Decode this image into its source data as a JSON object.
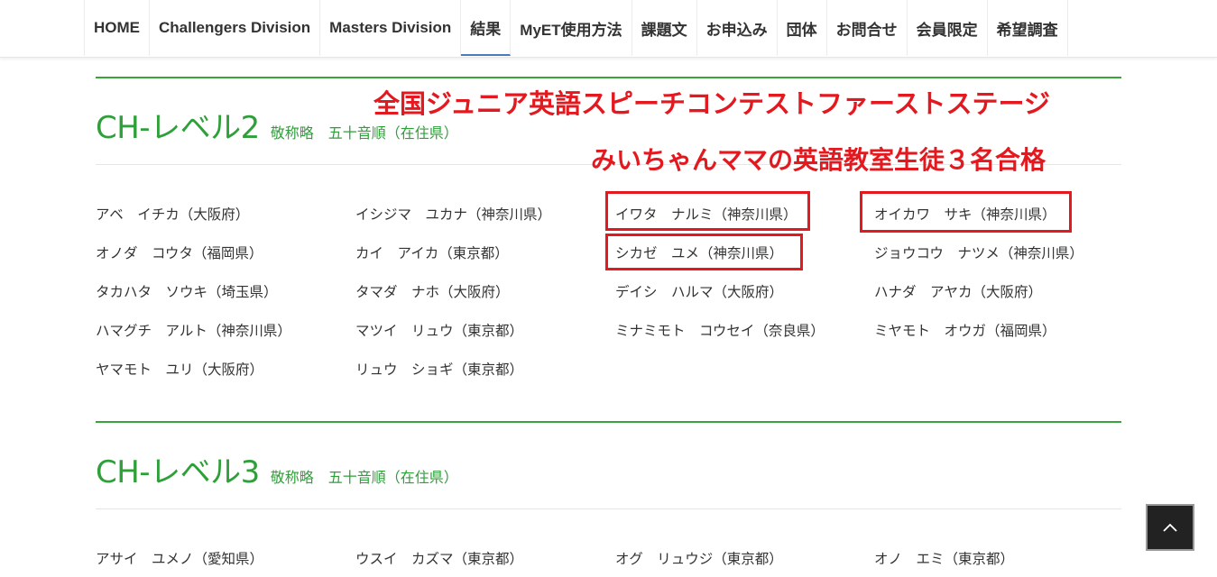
{
  "nav": {
    "items": [
      "HOME",
      "Challengers Division",
      "Masters Division",
      "結果",
      "MyET使用方法",
      "課題文",
      "お申込み",
      "団体",
      "お問合せ",
      "会員限定",
      "希望調査"
    ],
    "active_index": 3
  },
  "annotation": {
    "line1": "全国ジュニア英語スピーチコンテストファーストステージ",
    "line2": "みいちゃんママの英語教室生徒３名合格",
    "color": "#e3191f"
  },
  "sections": [
    {
      "title": "CH-レベル2",
      "subtitle": "敬称略　五十音順（在住県）",
      "names": [
        "アベ　イチカ（大阪府）",
        "イシジマ　ユカナ（神奈川県）",
        "イワタ　ナルミ（神奈川県）",
        "オイカワ　サキ（神奈川県）",
        "オノダ　コウタ（福岡県）",
        "カイ　アイカ（東京都）",
        "シカゼ　ユメ（神奈川県）",
        "ジョウコウ　ナツメ（神奈川県）",
        "タカハタ　ソウキ（埼玉県）",
        "タマダ　ナホ（大阪府）",
        "デイシ　ハルマ（大阪府）",
        "ハナダ　アヤカ（大阪府）",
        "ハマグチ　アルト（神奈川県）",
        "マツイ　リュウ（東京都）",
        "ミナミモト　コウセイ（奈良県）",
        "ミヤモト　オウガ（福岡県）",
        "ヤマモト　ユリ（大阪府）",
        "リュウ　ショギ（東京都）"
      ]
    },
    {
      "title": "CH-レベル3",
      "subtitle": "敬称略　五十音順（在住県）",
      "names": [
        "アサイ　ユメノ（愛知県）",
        "ウスイ　カズマ（東京都）",
        "オグ　リュウジ（東京都）",
        "オノ　エミ（東京都）"
      ]
    }
  ],
  "colors": {
    "accent_green": "#2fa039",
    "nav_active": "#4a7bbd"
  },
  "back_to_top_icon": "chevron-up-icon"
}
